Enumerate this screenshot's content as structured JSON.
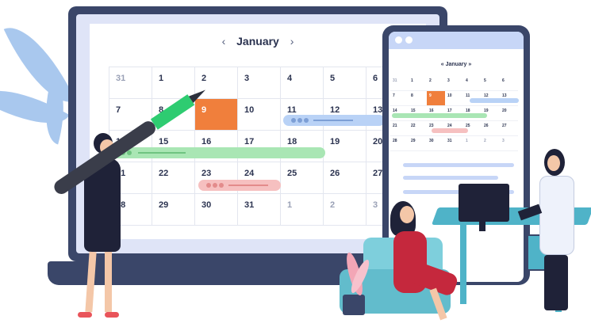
{
  "laptop_calendar": {
    "month": "January",
    "prev_icon": "‹",
    "next_icon": "›",
    "rows": [
      [
        "31",
        "1",
        "2",
        "3",
        "4",
        "5",
        "6"
      ],
      [
        "7",
        "8",
        "9",
        "10",
        "11",
        "12",
        "13"
      ],
      [
        "14",
        "15",
        "16",
        "17",
        "18",
        "19",
        "20"
      ],
      [
        "21",
        "22",
        "23",
        "24",
        "25",
        "26",
        "27"
      ],
      [
        "28",
        "29",
        "30",
        "31",
        "1",
        "2",
        "3"
      ]
    ],
    "highlight": "9",
    "accent": "#f07f3c"
  },
  "phone_calendar": {
    "month": "January",
    "rows": [
      [
        "31",
        "1",
        "2",
        "3",
        "4",
        "5",
        "6"
      ],
      [
        "7",
        "8",
        "9",
        "10",
        "11",
        "12",
        "13"
      ],
      [
        "14",
        "15",
        "16",
        "17",
        "18",
        "19",
        "20"
      ],
      [
        "21",
        "22",
        "23",
        "24",
        "25",
        "26",
        "27"
      ],
      [
        "28",
        "29",
        "30",
        "31",
        "1",
        "2",
        "3"
      ]
    ]
  },
  "colors": {
    "event_blue": "#b9d2f6",
    "event_green": "#a9e6b4",
    "event_pink": "#f6c0c0",
    "frame": "#3a4669"
  }
}
